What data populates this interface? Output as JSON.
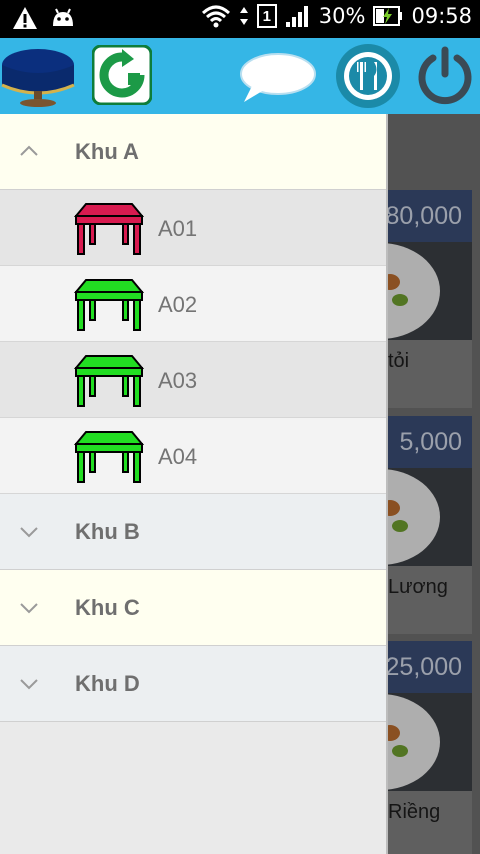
{
  "status_bar": {
    "battery": "30%",
    "time": "09:58",
    "sim_slot": "1",
    "icons": [
      "warning-icon",
      "android-icon",
      "wifi-icon",
      "sim-icon",
      "signal-icon",
      "battery-charging-icon"
    ]
  },
  "toolbar": {
    "icons": [
      "table-round-icon",
      "refresh-icon",
      "chat-bubble-icon",
      "dining-icon",
      "power-icon"
    ]
  },
  "drawer": {
    "groups": [
      {
        "label": "Khu A",
        "expanded": true,
        "bg": "#fffff0"
      },
      {
        "label": "Khu B",
        "expanded": false,
        "bg": "#eceff1"
      },
      {
        "label": "Khu C",
        "expanded": false,
        "bg": "#fffff0"
      },
      {
        "label": "Khu D",
        "expanded": false,
        "bg": "#eceff1"
      }
    ],
    "tables": [
      {
        "label": "A01",
        "color": "#d81b50",
        "bg": "#e5e5e5"
      },
      {
        "label": "A02",
        "color": "#22dd22",
        "bg": "#f3f3f3"
      },
      {
        "label": "A03",
        "color": "#22dd22",
        "bg": "#e5e5e5"
      },
      {
        "label": "A04",
        "color": "#22dd22",
        "bg": "#f3f3f3"
      }
    ]
  },
  "menu_items": [
    {
      "price": "80,000",
      "caption": "tỏi"
    },
    {
      "price": "5,000",
      "caption": "Lương"
    },
    {
      "price": "25,000",
      "caption": "Riềng"
    }
  ],
  "colors": {
    "appbar": "#35b6e6",
    "occupied": "#d81b50",
    "available": "#22dd22"
  }
}
